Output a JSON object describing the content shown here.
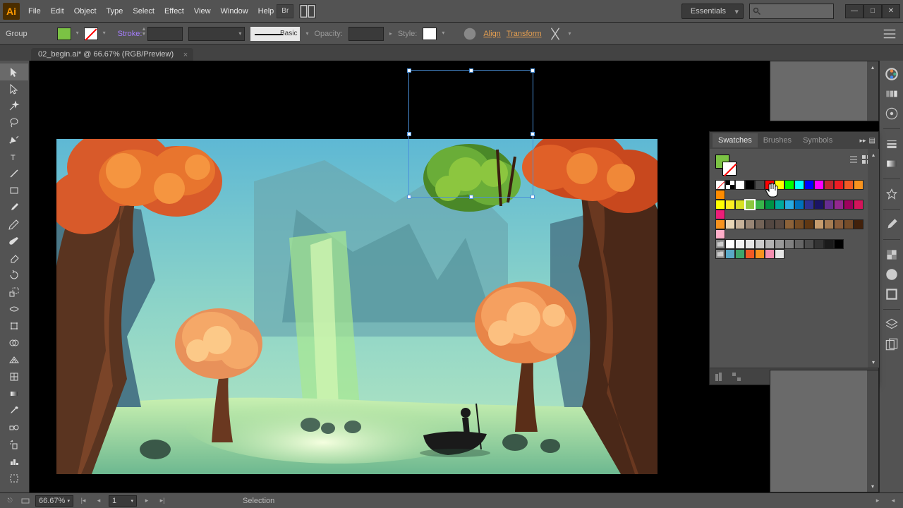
{
  "menu": [
    "File",
    "Edit",
    "Object",
    "Type",
    "Select",
    "Effect",
    "View",
    "Window",
    "Help"
  ],
  "workspace": "Essentials",
  "ctrl": {
    "group": "Group",
    "stroke": "Stroke:",
    "basic": "Basic",
    "opacity": "Opacity:",
    "style": "Style:",
    "align": "Align",
    "transform": "Transform"
  },
  "doc_tab": "02_begin.ai* @ 66.67% (RGB/Preview)",
  "panel_tabs": [
    "Swatches",
    "Brushes",
    "Symbols"
  ],
  "swatches_rows": [
    [
      "none",
      "reg",
      "#ffffff",
      "#000000",
      "#4d4d4d",
      "#ff0000",
      "#ffff00",
      "#00ff00",
      "#00ffff",
      "#0000ff",
      "#ff00ff",
      "#c1272d",
      "#ed1c24",
      "#f15a24",
      "#f7931e",
      "#ff8c00"
    ],
    [
      "#ffff00",
      "#fcee21",
      "#d9e021",
      "#8cc63f",
      "#39b54a",
      "#009245",
      "#00a99d",
      "#29abe2",
      "#0071bc",
      "#2e3192",
      "#1b1464",
      "#662d91",
      "#93278f",
      "#9e005d",
      "#d4145a",
      "#ed1e79"
    ],
    [
      "#f7931e",
      "#e8d5b5",
      "#c7b299",
      "#998675",
      "#736357",
      "#534741",
      "#594a42",
      "#8c6239",
      "#754c24",
      "#603813",
      "#c69c6d",
      "#a67c52",
      "#8a5d3b",
      "#754c29",
      "#42210b",
      "#ffaec9"
    ],
    [
      "#ffffff",
      "#f2f2f2",
      "#e6e6e6",
      "#cccccc",
      "#b3b3b3",
      "#999999",
      "#808080",
      "#666666",
      "#4d4d4d",
      "#333333",
      "#1a1a1a",
      "#000000"
    ],
    [
      "#5aa9c7",
      "#3fa66b",
      "#f15a24",
      "#f7931e",
      "#f48fb1",
      "#e6e6e6"
    ]
  ],
  "selected_swatch": [
    1,
    3
  ],
  "status": {
    "zoom": "66.67%",
    "page": "1",
    "tool": "Selection"
  },
  "fill_color": "#7bc244"
}
